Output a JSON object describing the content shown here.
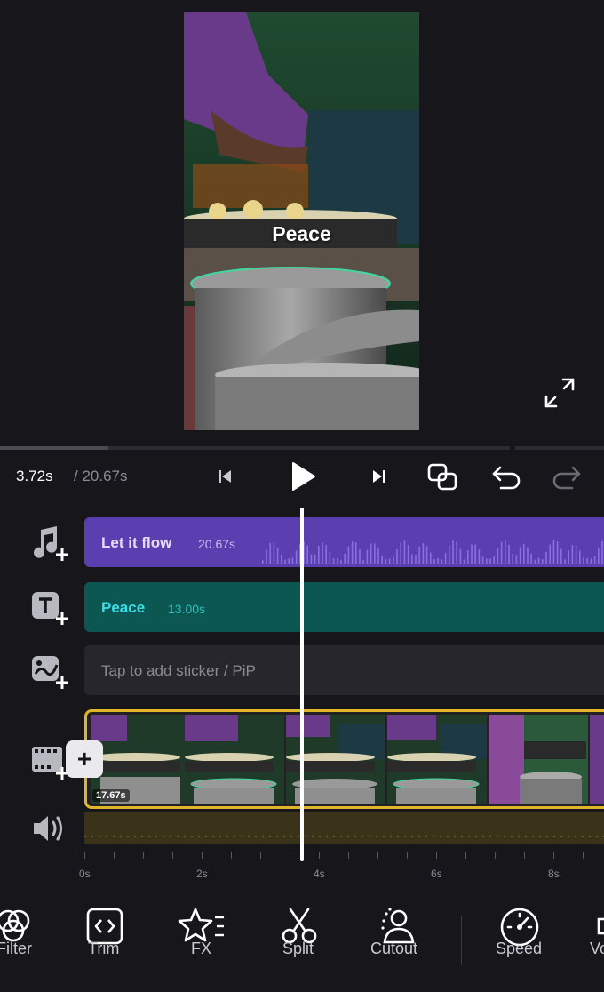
{
  "preview": {
    "overlay_text": "Peace"
  },
  "playback": {
    "current_time": "3.72s",
    "total_time": "/ 20.67s",
    "progress_fraction": 0.18
  },
  "tracks": {
    "music": {
      "title": "Let it flow",
      "duration": "20.67s",
      "icon": "music-add-icon"
    },
    "text": {
      "title": "Peace",
      "duration": "13.00s",
      "icon": "text-add-icon"
    },
    "sticker": {
      "placeholder": "Tap to add sticker / PiP",
      "icon": "sticker-add-icon"
    },
    "video": {
      "clip_duration": "17.67s",
      "icon": "video-add-icon",
      "add_label": "+"
    },
    "audio": {
      "icon": "volume-icon"
    }
  },
  "ruler": {
    "labels": [
      "0s",
      "2s",
      "4s",
      "6s",
      "8s"
    ]
  },
  "toolbar": {
    "items": [
      {
        "label": "Filter",
        "icon": "filter-icon"
      },
      {
        "label": "Trim",
        "icon": "trim-icon"
      },
      {
        "label": "FX",
        "icon": "fx-icon"
      },
      {
        "label": "Split",
        "icon": "scissors-icon"
      },
      {
        "label": "Cutout",
        "icon": "cutout-icon"
      },
      {
        "label": "Speed",
        "icon": "speed-icon"
      },
      {
        "label": "Vo",
        "icon": "volume-tool-icon"
      }
    ]
  },
  "colors": {
    "background": "#17171b",
    "music_track": "#5b3fb0",
    "text_track": "#0d5752",
    "video_border": "#e2b42a",
    "text_track_label": "#37e0e6"
  }
}
